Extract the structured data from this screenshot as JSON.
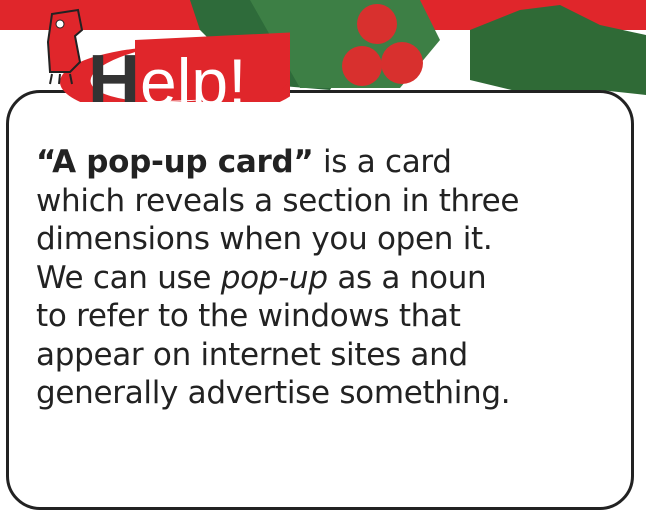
{
  "logo": {
    "text_h": "H",
    "text_rest": "elp!"
  },
  "body": {
    "term": "“A pop-up card”",
    "line1_rest": " is a card",
    "line2": "which reveals a section in three",
    "line3": "dimensions when you open it.",
    "line4_pre": "We can use ",
    "line4_em": "pop-up",
    "line4_post": " as a noun",
    "line5": "to refer to the windows that",
    "line6": "appear on internet sites and",
    "line7": "generally advertise something."
  },
  "colors": {
    "accent": "#e0262b",
    "leaf": "#2e6b3a",
    "border": "#222222"
  }
}
